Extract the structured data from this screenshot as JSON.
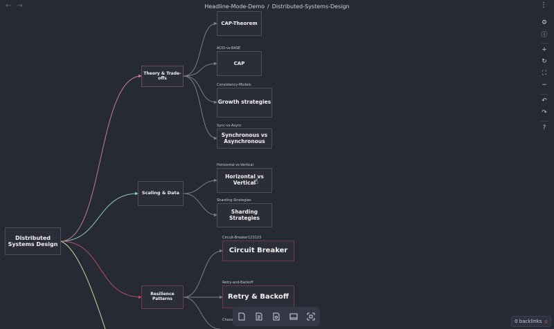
{
  "window": {
    "vault": "Headline-Mode-Demo",
    "separator": "/",
    "file": "Distributed-Systems-Design"
  },
  "nav": {
    "back_icon": "arrow-left-icon",
    "forward_icon": "arrow-right-icon",
    "more_icon": "more-vertical-icon"
  },
  "canvas": {
    "root": {
      "text": "Distributed Systems Design"
    },
    "branches": [
      {
        "id": "theory",
        "text": "Theory & Trade-offs"
      },
      {
        "id": "scaling",
        "text": "Scaling & Data"
      },
      {
        "id": "resilience",
        "text": "Resilience Patterns"
      }
    ],
    "leaves": [
      {
        "label": "",
        "text": "CAP-Theorem"
      },
      {
        "label": "ACID-vs-BASE",
        "text": "CAP"
      },
      {
        "label": "Consistency-Models",
        "text": "Growth strategies"
      },
      {
        "label": "Sync-vs-Async",
        "text": "Synchronous vs Asynchronous"
      },
      {
        "label": "Horizontal-vs-Vertical",
        "text": "Horizontal vs Vertical"
      },
      {
        "label": "Sharding-Strategies",
        "text": "Sharding Strategies"
      },
      {
        "label": "Circuit-Breaker123123",
        "text": "Circuit Breaker"
      },
      {
        "label": "Retry-and-Backoff",
        "text": "Retry & Backoff"
      },
      {
        "label": "Chaos-",
        "text": ""
      }
    ],
    "edge_colors": {
      "theory": "#c77d8f",
      "scaling": "#8fc9c4",
      "resilience": "#b8505c",
      "fourth": "#c8d7a0",
      "child": "#7a7f8c"
    }
  },
  "right_toolbar": [
    "settings-icon",
    "info-icon",
    "zoom-in-icon",
    "reset-icon",
    "fit-icon",
    "zoom-out-icon",
    "undo-icon",
    "redo-icon",
    "help-icon"
  ],
  "bottom_toolbar": [
    "new-note-icon",
    "new-file-icon",
    "new-media-icon",
    "new-group-icon",
    "new-link-icon"
  ],
  "status": {
    "backlinks": "0 backlinks"
  }
}
